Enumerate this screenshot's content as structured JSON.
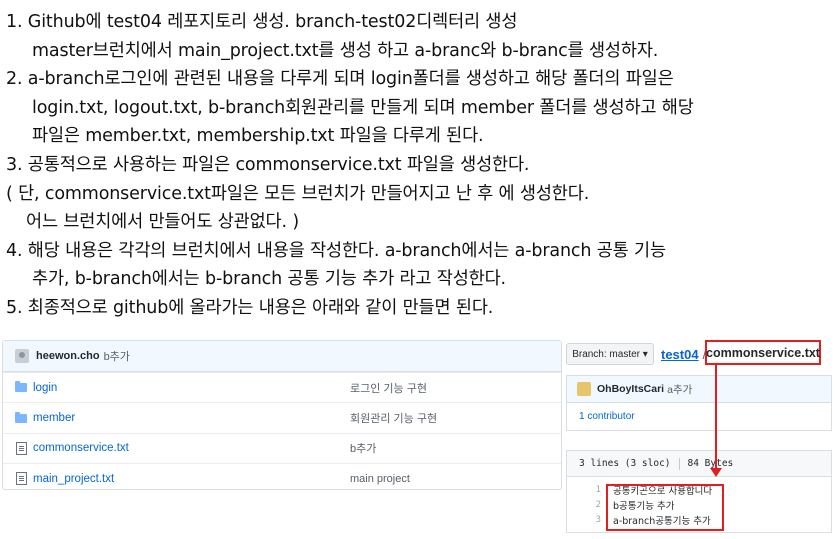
{
  "instructions": [
    "1. Github에 test04 레포지토리 생성. branch-test02디렉터리 생성",
    "master브런치에서 main_project.txt를 생성 하고 a-branc와 b-branc를 생성하자.",
    "2. a-branch로그인에 관련된 내용을 다루게 되며 login폴더를 생성하고 해당 폴더의 파일은",
    "login.txt, logout.txt, b-branch회원관리를 만들게 되며 member 폴더를 생성하고 해당",
    "파일은 member.txt, membership.txt 파일을 다루게 된다.",
    "3. 공통적으로 사용하는 파일은 commonservice.txt 파일을 생성한다.",
    "( 단, commonservice.txt파일은 모든 브런치가 만들어지고 난 후 에 생성한다.",
    "어느 브런치에서 만들어도 상관없다. )",
    "4. 해당 내용은 각각의 브런치에서 내용을 작성한다. a-branch에서는 a-branch 공통 기능",
    "추가, b-branch에서는 b-branch 공통 기능 추가 라고 작성한다.",
    "5. 최종적으로 github에 올라가는 내용은 아래와 같이 만들면 된다."
  ],
  "repo": {
    "user": "heewon.cho",
    "commit_message": "b추가",
    "files": [
      {
        "name": "login",
        "type": "folder",
        "message": "로그인 기능 구현"
      },
      {
        "name": "member",
        "type": "folder",
        "message": "회원관리 기능 구현"
      },
      {
        "name": "commonservice.txt",
        "type": "file",
        "message": "b추가"
      },
      {
        "name": "main_project.txt",
        "type": "file",
        "message": "main project"
      }
    ]
  },
  "file_view": {
    "branch_label": "Branch: master ▾",
    "repo_name": "test04",
    "separator": "/",
    "file_name": "commonservice.txt",
    "commit_user": "OhBoyItsCari",
    "commit_message": "a추가",
    "contributors": "1 contributor",
    "lines_info": "3 lines (3 sloc)",
    "size_info": "84 Bytes",
    "code_lines": [
      {
        "num": "1",
        "text": "공통키곤으로 사용합니다"
      },
      {
        "num": "2",
        "text": "b공통기능 추가"
      },
      {
        "num": "3",
        "text": "a-branch공통기능 추가"
      }
    ]
  },
  "colors": {
    "highlight": "#e02020",
    "link": "#0366d6"
  }
}
